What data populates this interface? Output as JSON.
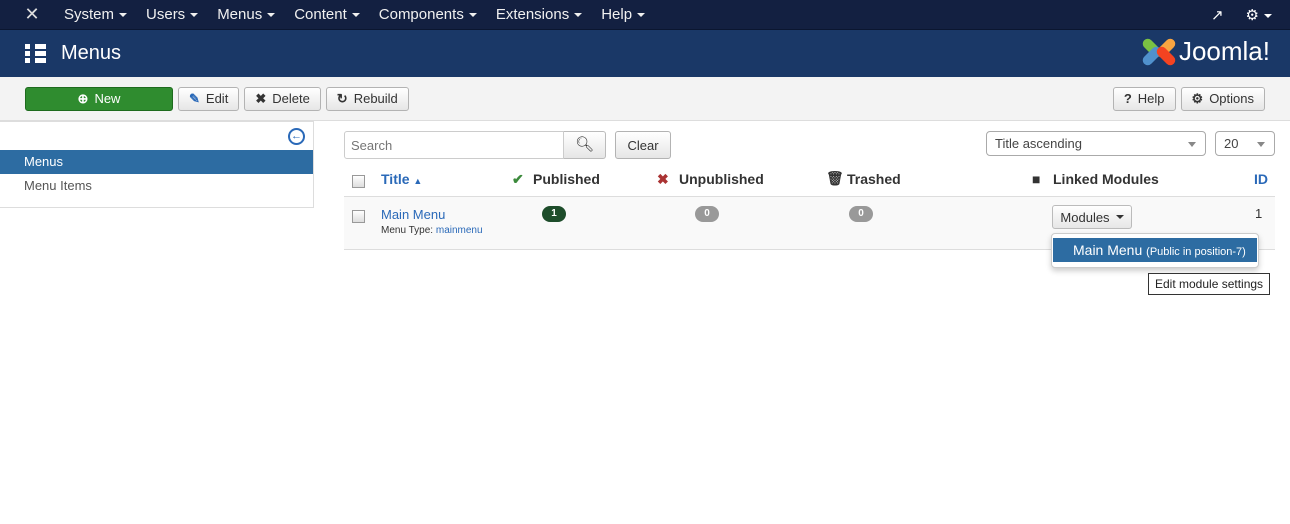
{
  "topnav": {
    "items": [
      "System",
      "Users",
      "Menus",
      "Content",
      "Components",
      "Extensions",
      "Help"
    ],
    "icons": [
      "joomla-icon",
      "external-link-icon",
      "gear-icon"
    ]
  },
  "header": {
    "title": "Menus",
    "brand": "Joomla!"
  },
  "toolbar": {
    "new": "New",
    "edit": "Edit",
    "delete": "Delete",
    "rebuild": "Rebuild",
    "help": "Help",
    "options": "Options"
  },
  "sidebar": {
    "items": [
      {
        "label": "Menus",
        "active": true
      },
      {
        "label": "Menu Items",
        "active": false
      }
    ]
  },
  "filters": {
    "search_placeholder": "Search",
    "clear": "Clear",
    "sort": "Title ascending",
    "limit": "20"
  },
  "table": {
    "headers": {
      "title": "Title",
      "published": "Published",
      "unpublished": "Unpublished",
      "trashed": "Trashed",
      "linked": "Linked Modules",
      "id": "ID"
    },
    "rows": [
      {
        "title": "Main Menu",
        "type_label": "Menu Type:",
        "type": "mainmenu",
        "published": "1",
        "unpublished": "0",
        "trashed": "0",
        "modules_button": "Modules",
        "id": "1"
      }
    ]
  },
  "dropdown": {
    "item": "Main Menu",
    "detail": "(Public in position-7)",
    "tooltip": "Edit module settings"
  },
  "colors": {
    "topnav": "#132041",
    "header": "#1a3867",
    "new_button": "#2f8c2f",
    "active": "#2d6ca2",
    "published_badge": "#1e4d2b",
    "zero_badge": "#999999"
  }
}
